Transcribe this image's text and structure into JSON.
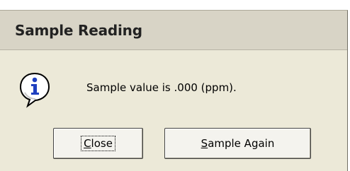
{
  "dialog": {
    "title": "Sample Reading",
    "icon": "information-icon",
    "message": "Sample value is .000 (ppm).",
    "buttons": {
      "close": {
        "accel": "C",
        "rest": "lose"
      },
      "sample_again": {
        "accel": "S",
        "rest": "ample Again"
      }
    }
  },
  "colors": {
    "dialog_face": "#ece9d8",
    "titlebar": "#d8d4c6",
    "icon_blue": "#1f3fbf"
  }
}
